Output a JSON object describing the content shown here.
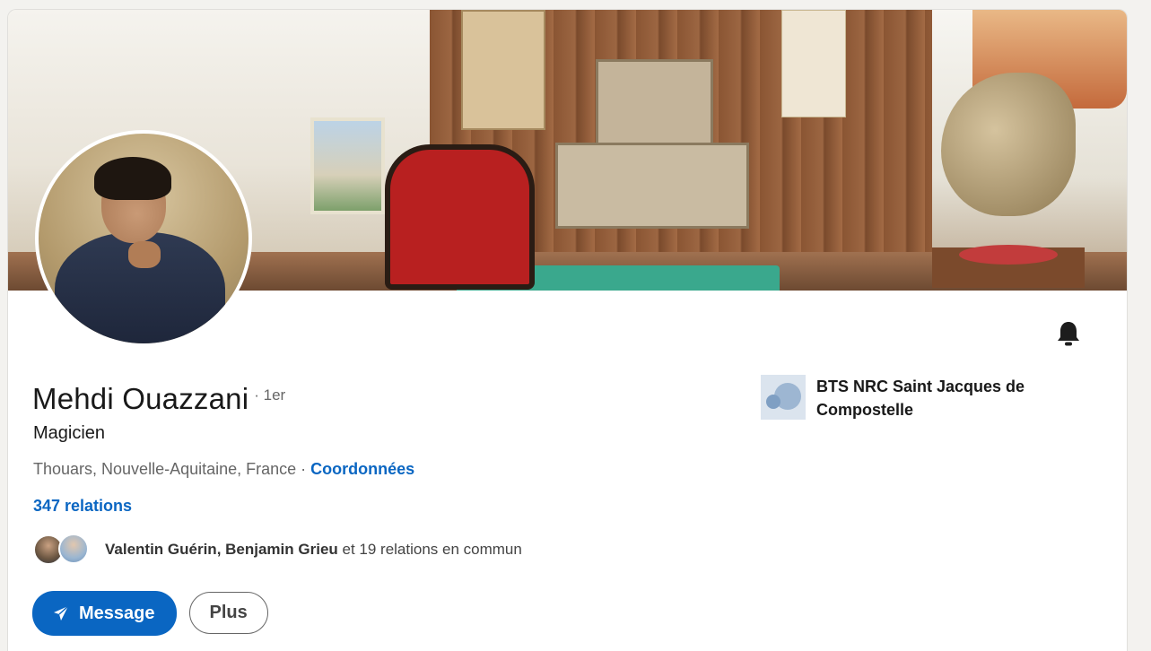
{
  "profile": {
    "name": "Mehdi Ouazzani",
    "degree": "· 1er",
    "headline": "Magicien",
    "location": "Thouars, Nouvelle-Aquitaine, France",
    "location_separator": "·",
    "contact_link": "Coordonnées",
    "relations": "347 relations"
  },
  "mutual": {
    "names": "Valentin Guérin, Benjamin Grieu",
    "rest": " et 19 relations en commun"
  },
  "actions": {
    "message_label": "Message",
    "more_label": "Plus"
  },
  "education": {
    "school": "BTS NRC Saint Jacques de Compostelle"
  },
  "icons": {
    "bell": "bell-icon",
    "send": "paper-plane-icon"
  },
  "colors": {
    "accent": "#0a66c2"
  }
}
